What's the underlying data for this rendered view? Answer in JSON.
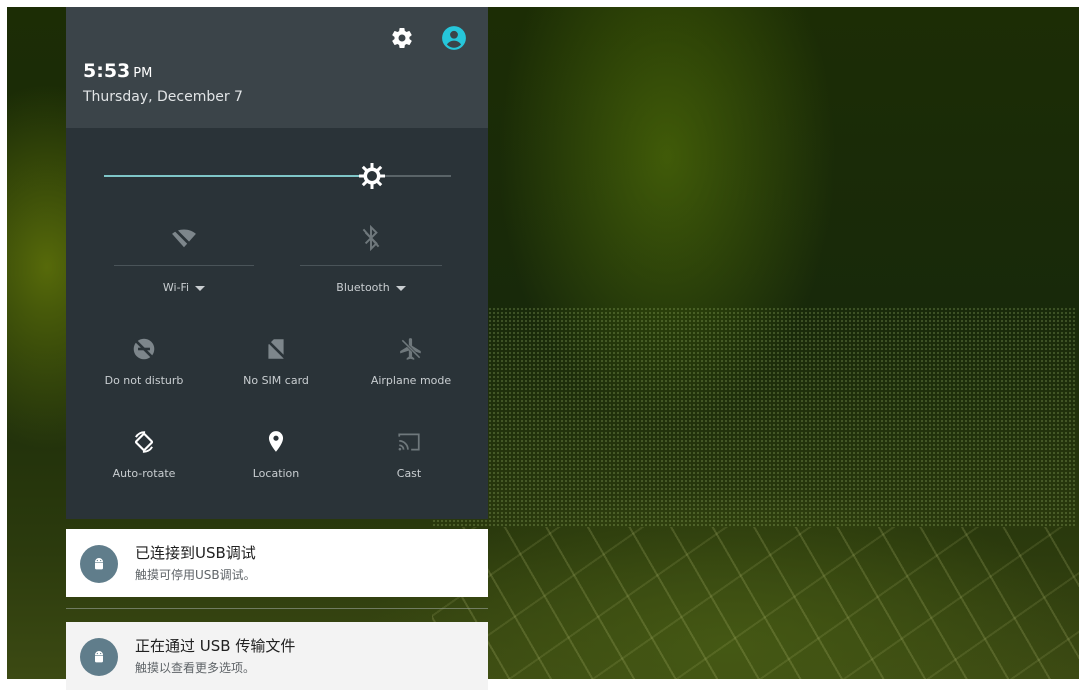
{
  "status": {
    "time": "5:53",
    "ampm": "PM",
    "date": "Thursday, December 7"
  },
  "header_icons": [
    "gear-icon",
    "account-circle-icon"
  ],
  "brightness": {
    "level_percent": 77
  },
  "tiles": {
    "wifi": {
      "label": "Wi-Fi",
      "icon": "wifi-off-icon",
      "active": false
    },
    "bluetooth": {
      "label": "Bluetooth",
      "icon": "bluetooth-off-icon",
      "active": false
    },
    "dnd": {
      "label": "Do not disturb",
      "icon": "do-not-disturb-icon",
      "active": false
    },
    "sim": {
      "label": "No SIM card",
      "icon": "no-sim-icon",
      "active": false
    },
    "airplane": {
      "label": "Airplane mode",
      "icon": "airplane-off-icon",
      "active": false
    },
    "rotate": {
      "label": "Auto-rotate",
      "icon": "auto-rotate-icon",
      "active": true
    },
    "location": {
      "label": "Location",
      "icon": "location-pin-icon",
      "active": true
    },
    "cast": {
      "label": "Cast",
      "icon": "cast-icon",
      "active": false
    }
  },
  "notifications": [
    {
      "title": "已连接到USB调试",
      "text": "触摸可停用USB调试。",
      "icon": "android-icon"
    },
    {
      "title": "正在通过 USB 传输文件",
      "text": "触摸以查看更多选项。",
      "icon": "android-icon"
    }
  ],
  "colors": {
    "accent": "#80cbc4",
    "account_icon": "#26c6da",
    "header_bg": "#3b4449",
    "tiles_bg": "#2a3338",
    "notification_icon_bg": "#607d8b"
  }
}
